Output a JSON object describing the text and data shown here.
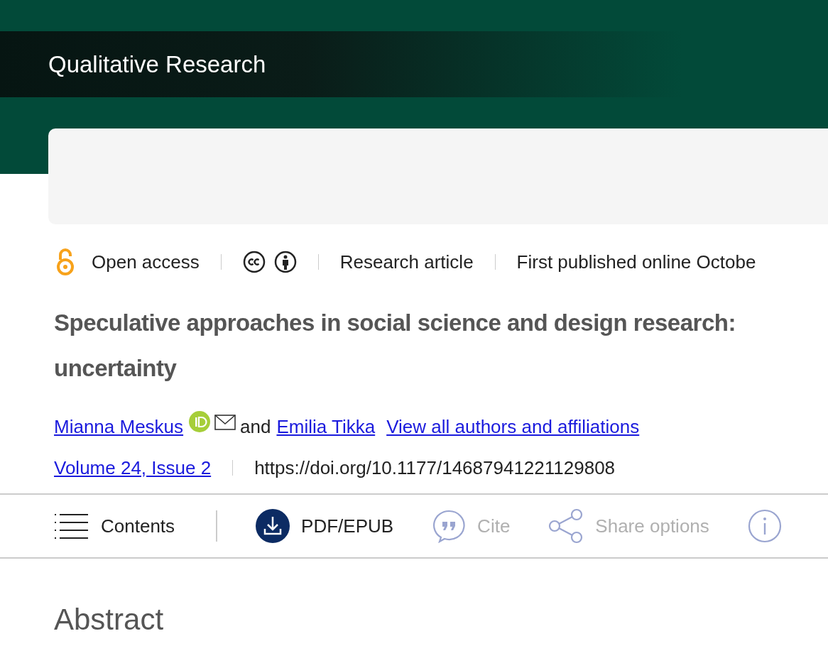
{
  "journal": {
    "title": "Qualitative Research"
  },
  "meta": {
    "access": "Open access",
    "article_type": "Research article",
    "published": "First published online Octobe"
  },
  "article": {
    "title_lines": [
      "Speculative approaches in social science and design research:",
      "uncertainty"
    ],
    "authors": [
      {
        "name": "Mianna Meskus",
        "orcid": true,
        "email": true
      },
      {
        "name": "Emilia Tikka",
        "orcid": false,
        "email": false
      }
    ],
    "author_joiner": "and",
    "all_authors_link": "View all authors and affiliations",
    "issue_link": "Volume 24, Issue 2",
    "doi": "https://doi.org/10.1177/14687941221129808"
  },
  "toolbar": [
    {
      "kind": "contents",
      "label": "Contents",
      "disabled": false
    },
    {
      "kind": "pdf",
      "label": "PDF/EPUB",
      "disabled": false
    },
    {
      "kind": "cite",
      "label": "Cite",
      "disabled": true
    },
    {
      "kind": "share",
      "label": "Share options",
      "disabled": true
    },
    {
      "kind": "info",
      "disabled": true
    }
  ],
  "section_heading": "Abstract"
}
